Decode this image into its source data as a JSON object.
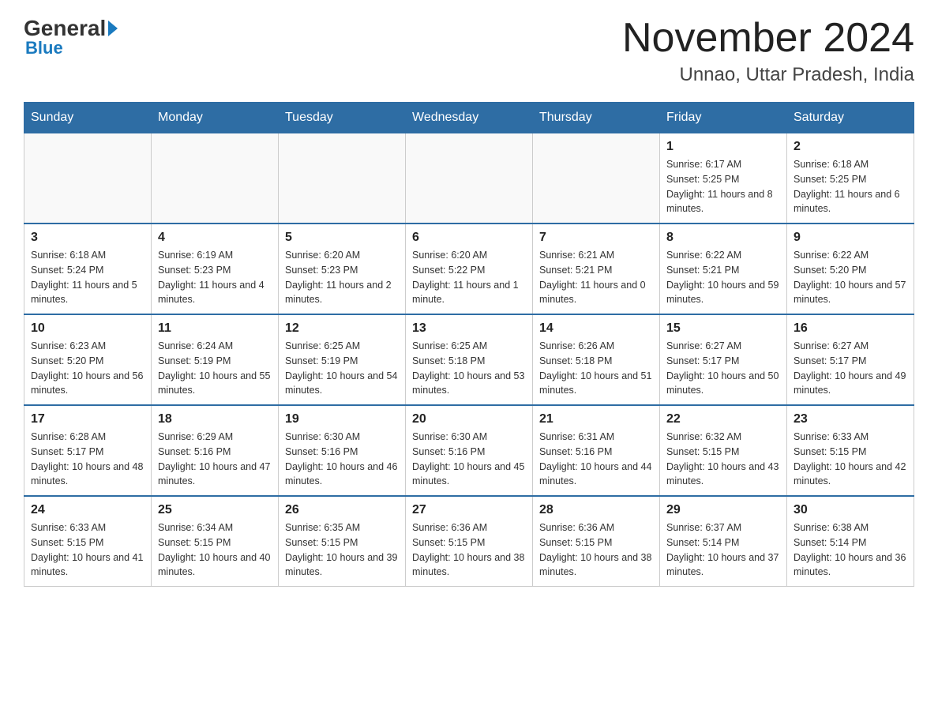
{
  "header": {
    "logo_general": "General",
    "logo_blue": "Blue",
    "main_title": "November 2024",
    "subtitle": "Unnao, Uttar Pradesh, India"
  },
  "calendar": {
    "days_of_week": [
      "Sunday",
      "Monday",
      "Tuesday",
      "Wednesday",
      "Thursday",
      "Friday",
      "Saturday"
    ],
    "weeks": [
      [
        {
          "day": "",
          "info": ""
        },
        {
          "day": "",
          "info": ""
        },
        {
          "day": "",
          "info": ""
        },
        {
          "day": "",
          "info": ""
        },
        {
          "day": "",
          "info": ""
        },
        {
          "day": "1",
          "info": "Sunrise: 6:17 AM\nSunset: 5:25 PM\nDaylight: 11 hours and 8 minutes."
        },
        {
          "day": "2",
          "info": "Sunrise: 6:18 AM\nSunset: 5:25 PM\nDaylight: 11 hours and 6 minutes."
        }
      ],
      [
        {
          "day": "3",
          "info": "Sunrise: 6:18 AM\nSunset: 5:24 PM\nDaylight: 11 hours and 5 minutes."
        },
        {
          "day": "4",
          "info": "Sunrise: 6:19 AM\nSunset: 5:23 PM\nDaylight: 11 hours and 4 minutes."
        },
        {
          "day": "5",
          "info": "Sunrise: 6:20 AM\nSunset: 5:23 PM\nDaylight: 11 hours and 2 minutes."
        },
        {
          "day": "6",
          "info": "Sunrise: 6:20 AM\nSunset: 5:22 PM\nDaylight: 11 hours and 1 minute."
        },
        {
          "day": "7",
          "info": "Sunrise: 6:21 AM\nSunset: 5:21 PM\nDaylight: 11 hours and 0 minutes."
        },
        {
          "day": "8",
          "info": "Sunrise: 6:22 AM\nSunset: 5:21 PM\nDaylight: 10 hours and 59 minutes."
        },
        {
          "day": "9",
          "info": "Sunrise: 6:22 AM\nSunset: 5:20 PM\nDaylight: 10 hours and 57 minutes."
        }
      ],
      [
        {
          "day": "10",
          "info": "Sunrise: 6:23 AM\nSunset: 5:20 PM\nDaylight: 10 hours and 56 minutes."
        },
        {
          "day": "11",
          "info": "Sunrise: 6:24 AM\nSunset: 5:19 PM\nDaylight: 10 hours and 55 minutes."
        },
        {
          "day": "12",
          "info": "Sunrise: 6:25 AM\nSunset: 5:19 PM\nDaylight: 10 hours and 54 minutes."
        },
        {
          "day": "13",
          "info": "Sunrise: 6:25 AM\nSunset: 5:18 PM\nDaylight: 10 hours and 53 minutes."
        },
        {
          "day": "14",
          "info": "Sunrise: 6:26 AM\nSunset: 5:18 PM\nDaylight: 10 hours and 51 minutes."
        },
        {
          "day": "15",
          "info": "Sunrise: 6:27 AM\nSunset: 5:17 PM\nDaylight: 10 hours and 50 minutes."
        },
        {
          "day": "16",
          "info": "Sunrise: 6:27 AM\nSunset: 5:17 PM\nDaylight: 10 hours and 49 minutes."
        }
      ],
      [
        {
          "day": "17",
          "info": "Sunrise: 6:28 AM\nSunset: 5:17 PM\nDaylight: 10 hours and 48 minutes."
        },
        {
          "day": "18",
          "info": "Sunrise: 6:29 AM\nSunset: 5:16 PM\nDaylight: 10 hours and 47 minutes."
        },
        {
          "day": "19",
          "info": "Sunrise: 6:30 AM\nSunset: 5:16 PM\nDaylight: 10 hours and 46 minutes."
        },
        {
          "day": "20",
          "info": "Sunrise: 6:30 AM\nSunset: 5:16 PM\nDaylight: 10 hours and 45 minutes."
        },
        {
          "day": "21",
          "info": "Sunrise: 6:31 AM\nSunset: 5:16 PM\nDaylight: 10 hours and 44 minutes."
        },
        {
          "day": "22",
          "info": "Sunrise: 6:32 AM\nSunset: 5:15 PM\nDaylight: 10 hours and 43 minutes."
        },
        {
          "day": "23",
          "info": "Sunrise: 6:33 AM\nSunset: 5:15 PM\nDaylight: 10 hours and 42 minutes."
        }
      ],
      [
        {
          "day": "24",
          "info": "Sunrise: 6:33 AM\nSunset: 5:15 PM\nDaylight: 10 hours and 41 minutes."
        },
        {
          "day": "25",
          "info": "Sunrise: 6:34 AM\nSunset: 5:15 PM\nDaylight: 10 hours and 40 minutes."
        },
        {
          "day": "26",
          "info": "Sunrise: 6:35 AM\nSunset: 5:15 PM\nDaylight: 10 hours and 39 minutes."
        },
        {
          "day": "27",
          "info": "Sunrise: 6:36 AM\nSunset: 5:15 PM\nDaylight: 10 hours and 38 minutes."
        },
        {
          "day": "28",
          "info": "Sunrise: 6:36 AM\nSunset: 5:15 PM\nDaylight: 10 hours and 38 minutes."
        },
        {
          "day": "29",
          "info": "Sunrise: 6:37 AM\nSunset: 5:14 PM\nDaylight: 10 hours and 37 minutes."
        },
        {
          "day": "30",
          "info": "Sunrise: 6:38 AM\nSunset: 5:14 PM\nDaylight: 10 hours and 36 minutes."
        }
      ]
    ]
  }
}
